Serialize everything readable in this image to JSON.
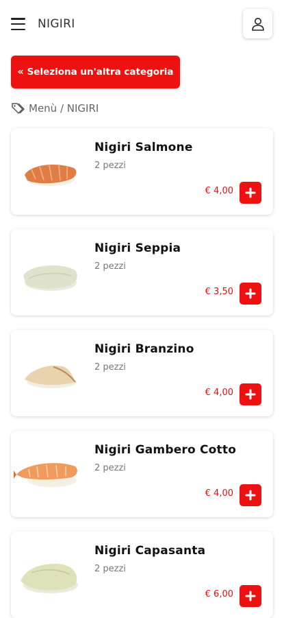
{
  "header": {
    "title": "NIGIRI",
    "menu_icon": "hamburger-menu-icon",
    "user_icon": "user-icon"
  },
  "category_button": {
    "icon": "double-chevron-left-icon",
    "chevron": "«",
    "label": "Seleziona un'altra categoria"
  },
  "breadcrumb": {
    "icon": "tag-icon",
    "text": "Menù / NIGIRI"
  },
  "colors": {
    "accent": "#ee1111",
    "price": "#dd1111"
  },
  "products": [
    {
      "name": "Nigiri Salmone",
      "description": "2 pezzi",
      "price": "€ 4,00",
      "image": "salmon-nigiri"
    },
    {
      "name": "Nigiri Seppia",
      "description": "2 pezzi",
      "price": "€ 3,50",
      "image": "cuttlefish-nigiri"
    },
    {
      "name": "Nigiri Branzino",
      "description": "2 pezzi",
      "price": "€ 4,00",
      "image": "seabass-nigiri"
    },
    {
      "name": "Nigiri Gambero Cotto",
      "description": "2 pezzi",
      "price": "€ 4,00",
      "image": "cooked-shrimp-nigiri"
    },
    {
      "name": "Nigiri Capasanta",
      "description": "2 pezzi",
      "price": "€ 6,00",
      "image": "scallop-nigiri"
    }
  ]
}
